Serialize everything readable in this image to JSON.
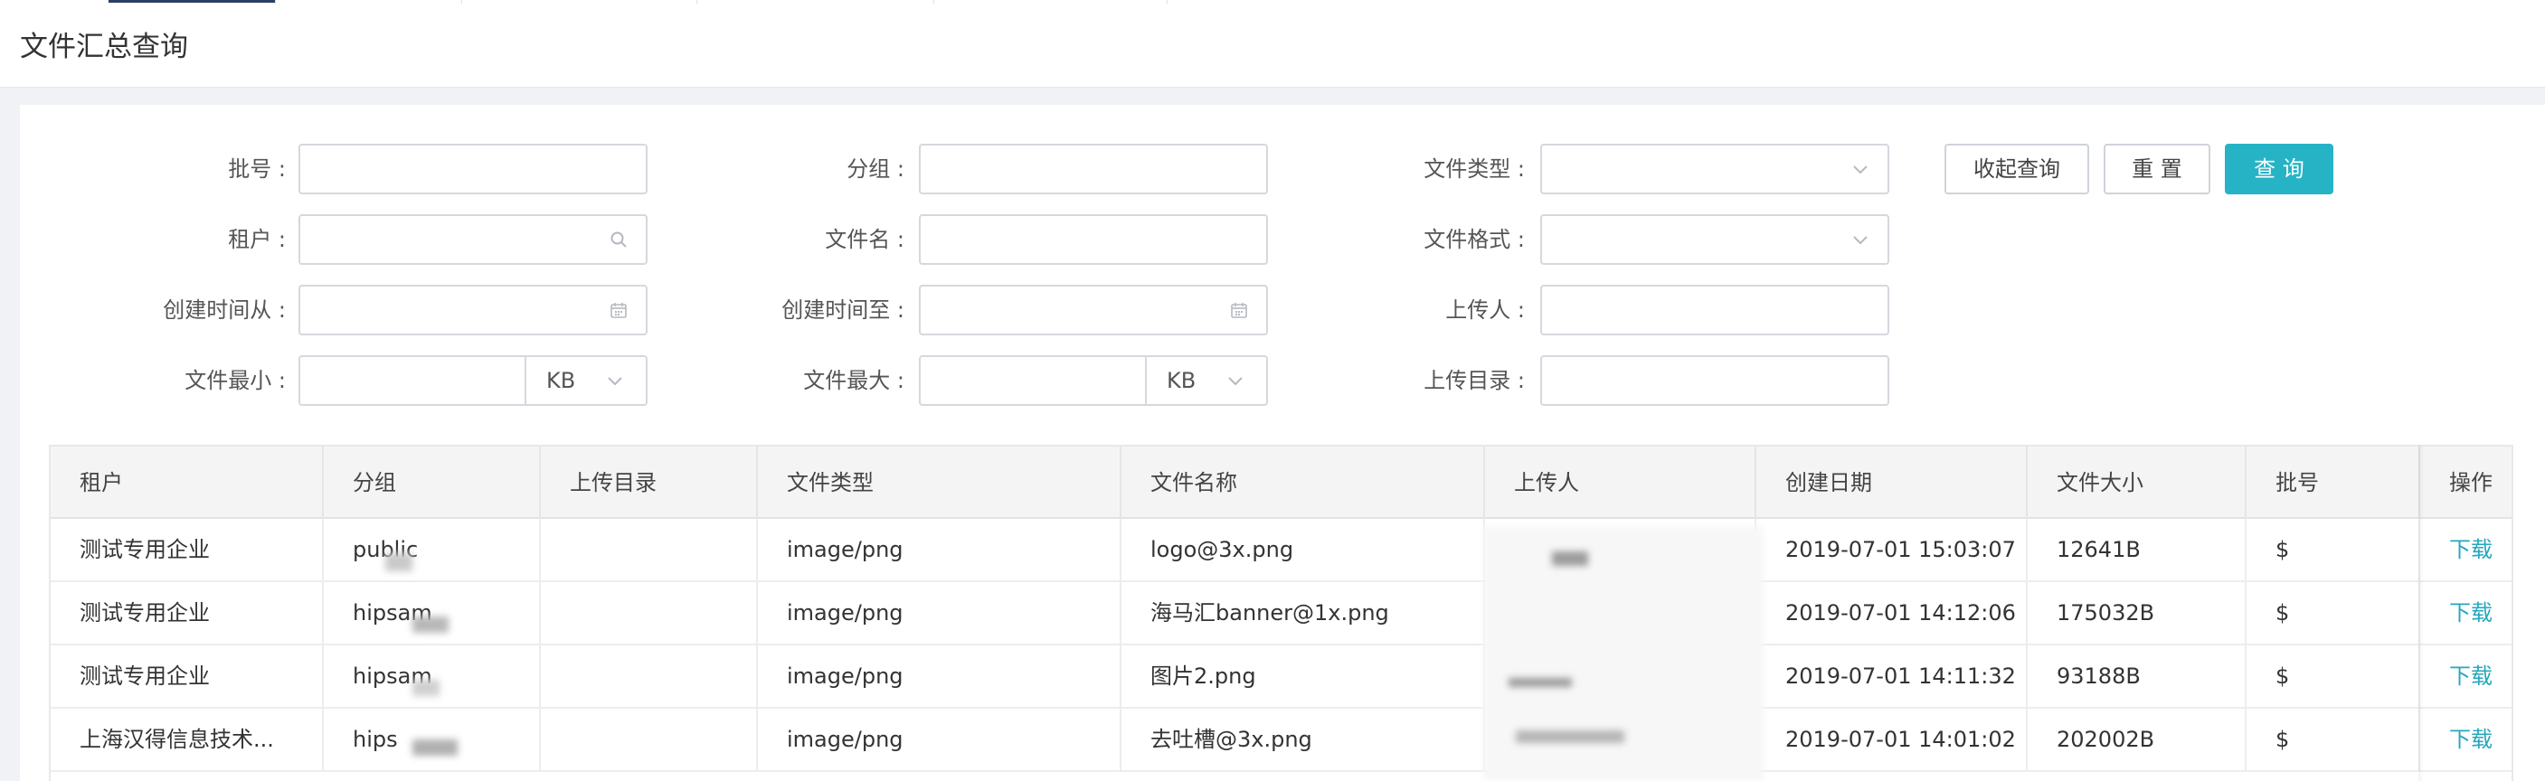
{
  "page": {
    "title": "文件汇总查询"
  },
  "form": {
    "batch_label": "批号 :",
    "group_label": "分组 :",
    "file_type_label": "文件类型 :",
    "tenant_label": "租户 :",
    "file_name_label": "文件名 :",
    "file_format_label": "文件格式 :",
    "created_from_label": "创建时间从 :",
    "created_to_label": "创建时间至 :",
    "uploader_label": "上传人 :",
    "min_size_label": "文件最小 :",
    "max_size_label": "文件最大 :",
    "upload_dir_label": "上传目录 :",
    "min_size_unit": "KB",
    "max_size_unit": "KB"
  },
  "buttons": {
    "collapse": "收起查询",
    "reset": "重 置",
    "search": "查 询"
  },
  "table": {
    "columns": [
      "租户",
      "分组",
      "上传目录",
      "文件类型",
      "文件名称",
      "上传人",
      "创建日期",
      "文件大小",
      "批号",
      "操作"
    ],
    "rows": [
      {
        "tenant": "测试专用企业",
        "group": "public",
        "dir": "",
        "type": "image/png",
        "name": "logo@3x.png",
        "uploader": "",
        "date": "2019-07-01 15:03:07",
        "size": "12641B",
        "batch": "$",
        "action": "下载"
      },
      {
        "tenant": "测试专用企业",
        "group": "hipsam",
        "dir": "",
        "type": "image/png",
        "name": "海马汇banner@1x.png",
        "uploader": "",
        "date": "2019-07-01 14:12:06",
        "size": "175032B",
        "batch": "$",
        "action": "下载"
      },
      {
        "tenant": "测试专用企业",
        "group": "hipsam",
        "dir": "",
        "type": "image/png",
        "name": "图片2.png",
        "uploader": "",
        "date": "2019-07-01 14:11:32",
        "size": "93188B",
        "batch": "$",
        "action": "下载"
      },
      {
        "tenant": "上海汉得信息技术...",
        "group": "hips",
        "dir": "",
        "type": "image/png",
        "name": "去吐槽@3x.png",
        "uploader": "",
        "date": "2019-07-01 14:01:02",
        "size": "202002B",
        "batch": "$",
        "action": "下载"
      }
    ]
  },
  "icons": {
    "search": "search-icon",
    "calendar": "calendar-icon",
    "dropdown": "chevron-down-icon"
  },
  "colors": {
    "primary": "#26b3c6",
    "link": "#26a7bd",
    "active_tab": "#2c3e66"
  }
}
